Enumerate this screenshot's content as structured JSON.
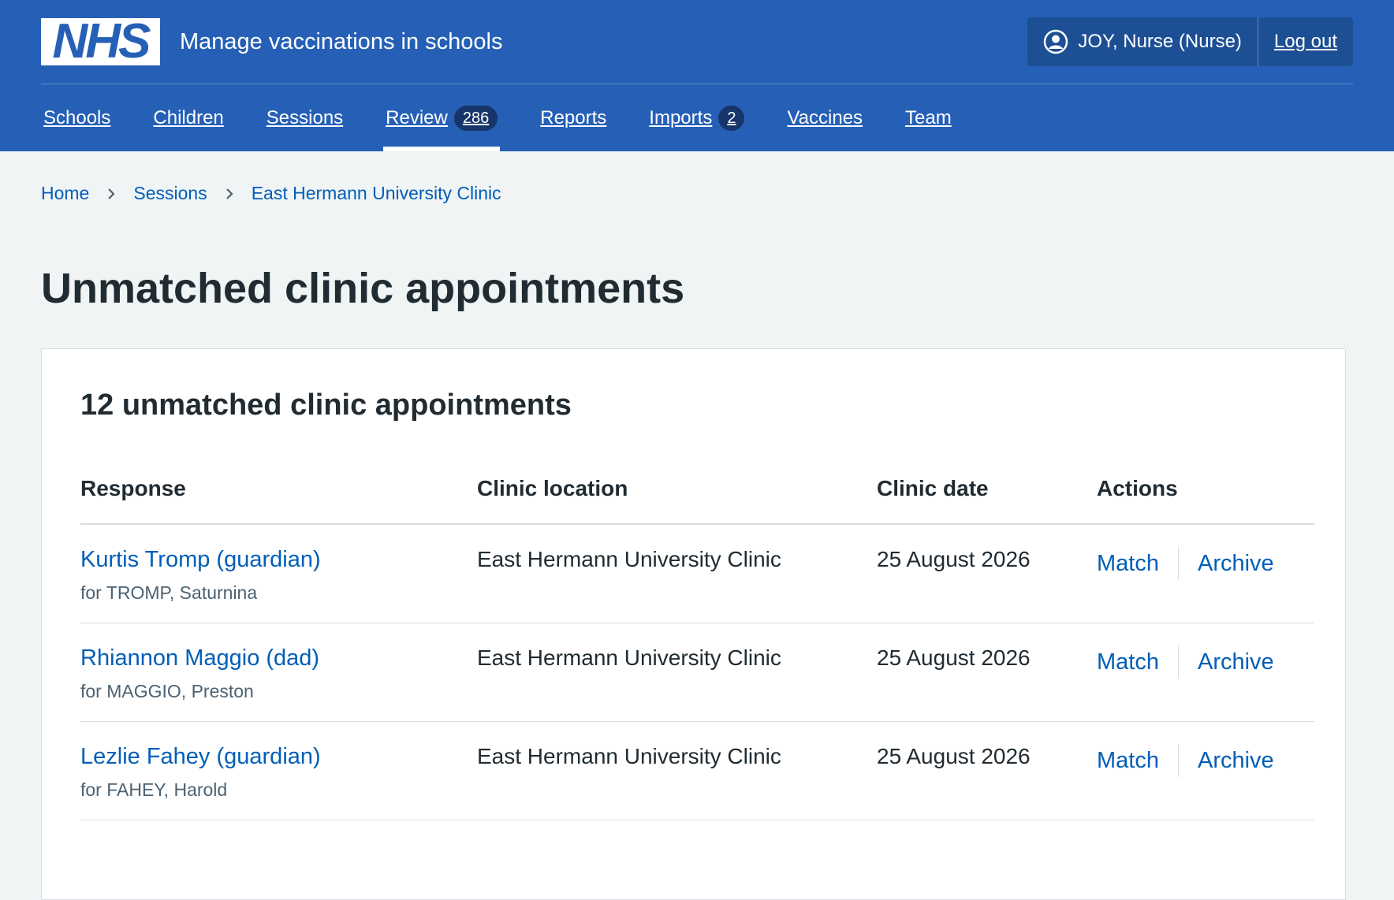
{
  "header": {
    "logo_text": "NHS",
    "service_name": "Manage vaccinations in schools",
    "user_label": "JOY, Nurse (Nurse)",
    "logout_label": "Log out",
    "nav": [
      {
        "label": "Schools",
        "count": null,
        "active": false
      },
      {
        "label": "Children",
        "count": null,
        "active": false
      },
      {
        "label": "Sessions",
        "count": null,
        "active": false
      },
      {
        "label": "Review",
        "count": "286",
        "active": true
      },
      {
        "label": "Reports",
        "count": null,
        "active": false
      },
      {
        "label": "Imports",
        "count": "2",
        "active": false
      },
      {
        "label": "Vaccines",
        "count": null,
        "active": false
      },
      {
        "label": "Team",
        "count": null,
        "active": false
      }
    ]
  },
  "breadcrumb": [
    "Home",
    "Sessions",
    "East Hermann University Clinic"
  ],
  "page_title": "Unmatched clinic appointments",
  "card": {
    "heading": "12 unmatched clinic appointments",
    "columns": [
      "Response",
      "Clinic location",
      "Clinic date",
      "Actions"
    ],
    "rows": [
      {
        "response": "Kurtis Tromp (guardian)",
        "for": "for TROMP, Saturnina",
        "location": "East Hermann University Clinic",
        "date": "25 August 2026",
        "match": "Match",
        "archive": "Archive"
      },
      {
        "response": "Rhiannon Maggio (dad)",
        "for": "for MAGGIO, Preston",
        "location": "East Hermann University Clinic",
        "date": "25 August 2026",
        "match": "Match",
        "archive": "Archive"
      },
      {
        "response": "Lezlie Fahey (guardian)",
        "for": "for FAHEY, Harold",
        "location": "East Hermann University Clinic",
        "date": "25 August 2026",
        "match": "Match",
        "archive": "Archive"
      }
    ]
  },
  "colors": {
    "header_blue": "#2660b6",
    "link_blue": "#005eb8",
    "background": "#f0f4f5"
  }
}
